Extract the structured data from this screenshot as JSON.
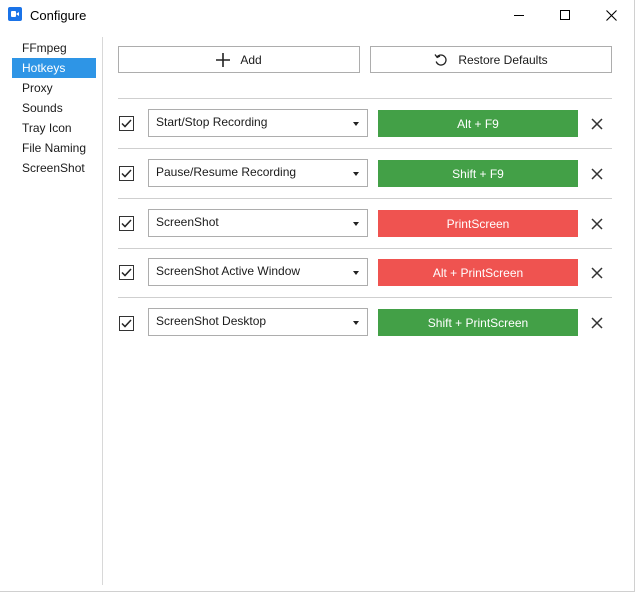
{
  "window": {
    "title": "Configure",
    "controls": {
      "minimize": "minimize-icon",
      "maximize": "maximize-icon",
      "close": "close-icon"
    }
  },
  "sidebar": {
    "items": [
      {
        "label": "FFmpeg",
        "active": false
      },
      {
        "label": "Hotkeys",
        "active": true
      },
      {
        "label": "Proxy",
        "active": false
      },
      {
        "label": "Sounds",
        "active": false
      },
      {
        "label": "Tray Icon",
        "active": false
      },
      {
        "label": "File Naming",
        "active": false
      },
      {
        "label": "ScreenShot",
        "active": false
      }
    ]
  },
  "toolbar": {
    "add_label": "Add",
    "restore_label": "Restore Defaults"
  },
  "colors": {
    "valid": "#43a047",
    "conflict": "#ef5350",
    "accent": "#2e95e6"
  },
  "hotkeys": [
    {
      "checked": true,
      "action": "Start/Stop Recording",
      "key": "Alt + F9",
      "status": "valid"
    },
    {
      "checked": true,
      "action": "Pause/Resume Recording",
      "key": "Shift + F9",
      "status": "valid"
    },
    {
      "checked": true,
      "action": "ScreenShot",
      "key": "PrintScreen",
      "status": "conflict"
    },
    {
      "checked": true,
      "action": "ScreenShot Active Window",
      "key": "Alt + PrintScreen",
      "status": "conflict"
    },
    {
      "checked": true,
      "action": "ScreenShot Desktop",
      "key": "Shift + PrintScreen",
      "status": "valid"
    }
  ]
}
